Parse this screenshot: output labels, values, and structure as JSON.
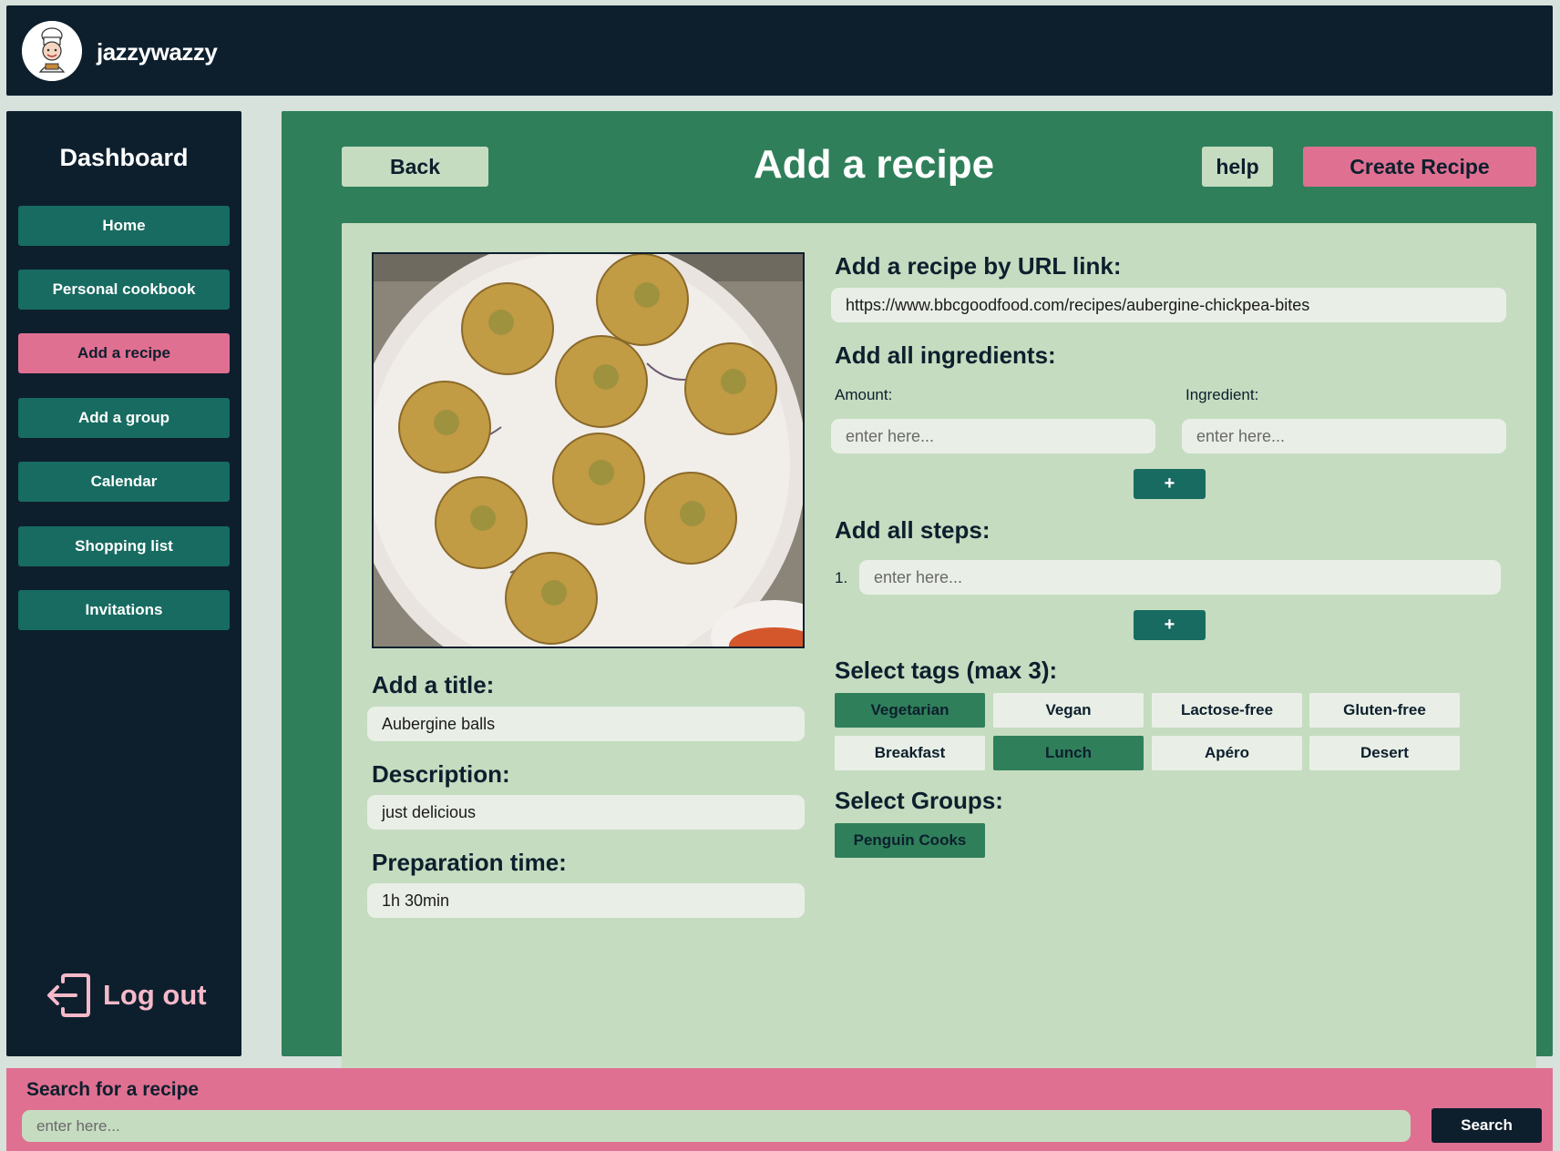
{
  "header": {
    "username": "jazzywazzy"
  },
  "sidebar": {
    "title": "Dashboard",
    "items": [
      {
        "label": "Home",
        "active": false
      },
      {
        "label": "Personal cookbook",
        "active": false
      },
      {
        "label": "Add a recipe",
        "active": true
      },
      {
        "label": "Add a group",
        "active": false
      },
      {
        "label": "Calendar",
        "active": false
      },
      {
        "label": "Shopping list",
        "active": false
      },
      {
        "label": "Invitations",
        "active": false
      }
    ],
    "logout_label": "Log out"
  },
  "main": {
    "back_label": "Back",
    "title": "Add a recipe",
    "help_label": "help",
    "create_label": "Create Recipe"
  },
  "form": {
    "title_label": "Add a title:",
    "title_value": "Aubergine balls",
    "description_label": "Description:",
    "description_value": "just delicious",
    "prep_label": "Preparation time:",
    "prep_value": "1h 30min",
    "url_label": "Add a recipe by URL link:",
    "url_value": "https://www.bbcgoodfood.com/recipes/aubergine-chickpea-bites",
    "ingredients_label": "Add all ingredients:",
    "amount_label": "Amount:",
    "ingredient_label": "Ingredient:",
    "placeholder": "enter here...",
    "add_label": "+",
    "steps_label": "Add all steps:",
    "step_number": "1.",
    "tags_label": "Select tags (max 3):",
    "tags": [
      {
        "label": "Vegetarian",
        "selected": true
      },
      {
        "label": "Vegan",
        "selected": false
      },
      {
        "label": "Lactose-free",
        "selected": false
      },
      {
        "label": "Gluten-free",
        "selected": false
      },
      {
        "label": "Breakfast",
        "selected": false
      },
      {
        "label": "Lunch",
        "selected": true
      },
      {
        "label": "Apéro",
        "selected": false
      },
      {
        "label": "Desert",
        "selected": false
      }
    ],
    "groups_label": "Select Groups:",
    "groups": [
      {
        "label": "Penguin Cooks",
        "selected": true
      }
    ]
  },
  "search": {
    "label": "Search for a recipe",
    "placeholder": "enter here...",
    "button_label": "Search"
  },
  "colors": {
    "dark_navy": "#0d1f2d",
    "main_green": "#2f7f5a",
    "nav_teal": "#176b61",
    "pale_green": "#c5dcc0",
    "pink": "#e07092",
    "field_bg": "#e9efe6"
  }
}
